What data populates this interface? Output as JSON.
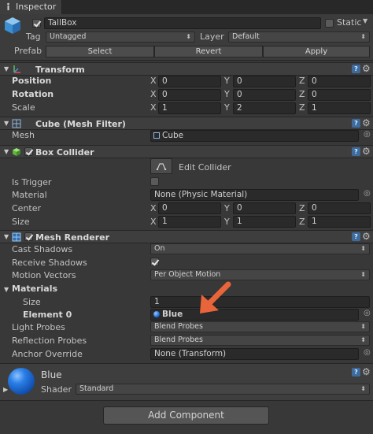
{
  "tab": {
    "label": "Inspector"
  },
  "object": {
    "name": "TallBox",
    "static_label": "Static",
    "tag_label": "Tag",
    "tag_value": "Untagged",
    "layer_label": "Layer",
    "layer_value": "Default",
    "prefab_label": "Prefab",
    "prefab_buttons": [
      "Select",
      "Revert",
      "Apply"
    ]
  },
  "transform": {
    "title": "Transform",
    "rows": [
      {
        "label": "Position",
        "x": "0",
        "y": "0",
        "z": "0"
      },
      {
        "label": "Rotation",
        "x": "0",
        "y": "0",
        "z": "0"
      },
      {
        "label": "Scale",
        "x": "1",
        "y": "2",
        "z": "1"
      }
    ]
  },
  "axes": {
    "x": "X",
    "y": "Y",
    "z": "Z"
  },
  "mesh_filter": {
    "title": "Cube (Mesh Filter)",
    "mesh_label": "Mesh",
    "mesh_value": "Cube"
  },
  "box_collider": {
    "title": "Box Collider",
    "edit_label": "Edit Collider",
    "is_trigger_label": "Is Trigger",
    "material_label": "Material",
    "material_value": "None (Physic Material)",
    "center_label": "Center",
    "center": {
      "x": "0",
      "y": "0",
      "z": "0"
    },
    "size_label": "Size",
    "size": {
      "x": "1",
      "y": "1",
      "z": "1"
    }
  },
  "mesh_renderer": {
    "title": "Mesh Renderer",
    "cast_label": "Cast Shadows",
    "cast_value": "On",
    "receive_label": "Receive Shadows",
    "motion_label": "Motion Vectors",
    "motion_value": "Per Object Motion",
    "materials_label": "Materials",
    "size_label": "Size",
    "size_value": "1",
    "element_label": "Element 0",
    "element_value": "Blue",
    "light_label": "Light Probes",
    "light_value": "Blend Probes",
    "reflection_label": "Reflection Probes",
    "reflection_value": "Blend Probes",
    "anchor_label": "Anchor Override",
    "anchor_value": "None (Transform)"
  },
  "material": {
    "name": "Blue",
    "shader_label": "Shader",
    "shader_value": "Standard"
  },
  "add_component": {
    "label": "Add Component"
  },
  "colors": {
    "background": "#383838",
    "header": "#3e3e3e",
    "field": "#2a2a2a",
    "accent": "#3d6b9e",
    "arrow": "#e8643a",
    "sphere": "#1f6fd6"
  }
}
